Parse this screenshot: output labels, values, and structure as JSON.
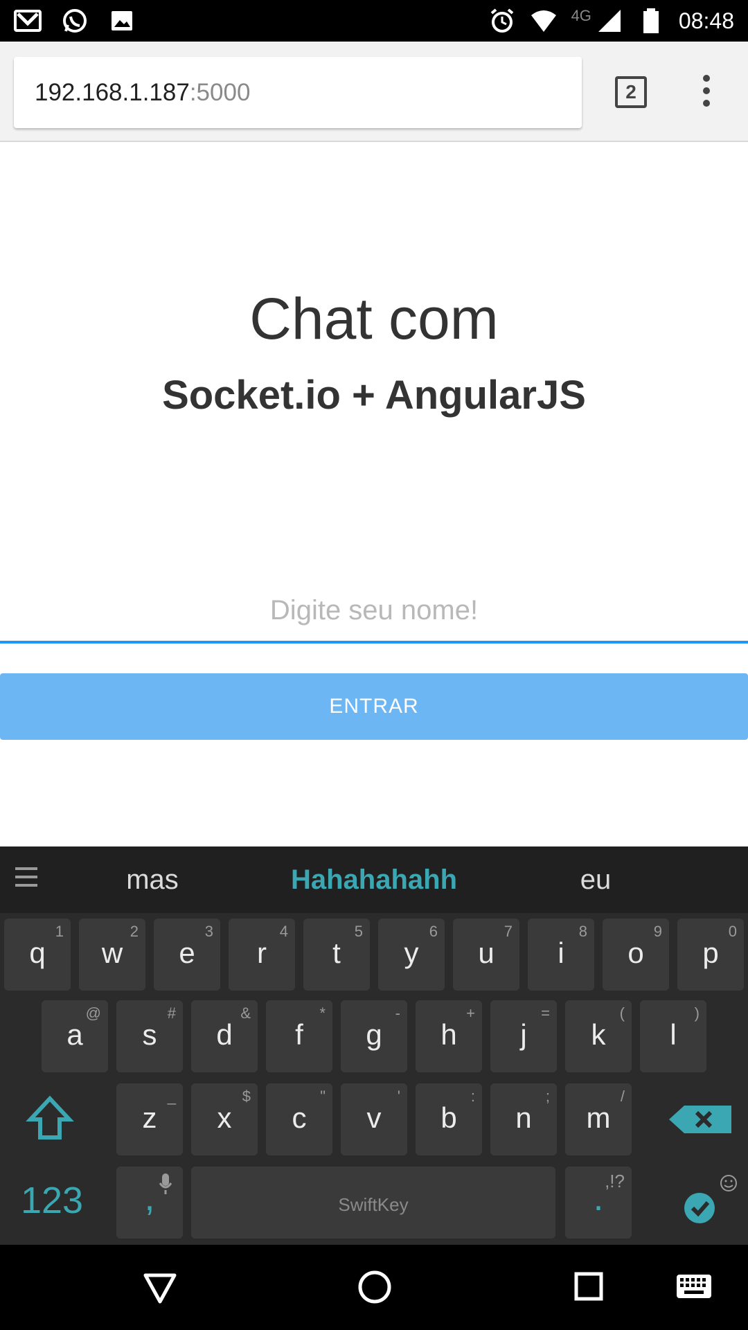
{
  "status_bar": {
    "time": "08:48",
    "network": "4G",
    "left_icons": [
      "gmail-icon",
      "whatsapp-icon",
      "gallery-icon"
    ],
    "right_icons": [
      "alarm-icon",
      "wifi-icon",
      "signal-icon",
      "battery-icon"
    ]
  },
  "browser": {
    "url_host": "192.168.1.187",
    "url_port": ":5000",
    "tab_count": "2",
    "menu_icon": "more-vert-icon"
  },
  "page": {
    "title": "Chat com",
    "subtitle": "Socket.io + AngularJS",
    "name_placeholder": "Digite seu nome!",
    "name_value": "",
    "enter_label": "ENTRAR",
    "accent_color": "#2196f3",
    "button_color": "#6db6f4"
  },
  "keyboard": {
    "suggestions": [
      "mas",
      "Hahahahahh",
      "eu"
    ],
    "row1": [
      {
        "k": "q",
        "h": "1"
      },
      {
        "k": "w",
        "h": "2"
      },
      {
        "k": "e",
        "h": "3"
      },
      {
        "k": "r",
        "h": "4"
      },
      {
        "k": "t",
        "h": "5"
      },
      {
        "k": "y",
        "h": "6"
      },
      {
        "k": "u",
        "h": "7"
      },
      {
        "k": "i",
        "h": "8"
      },
      {
        "k": "o",
        "h": "9"
      },
      {
        "k": "p",
        "h": "0"
      }
    ],
    "row2": [
      {
        "k": "a",
        "h": "@"
      },
      {
        "k": "s",
        "h": "#"
      },
      {
        "k": "d",
        "h": "&"
      },
      {
        "k": "f",
        "h": "*"
      },
      {
        "k": "g",
        "h": "-"
      },
      {
        "k": "h",
        "h": "+"
      },
      {
        "k": "j",
        "h": "="
      },
      {
        "k": "k",
        "h": "("
      },
      {
        "k": "l",
        "h": ")"
      }
    ],
    "row3": [
      {
        "k": "z",
        "h": "_"
      },
      {
        "k": "x",
        "h": "$"
      },
      {
        "k": "c",
        "h": "\""
      },
      {
        "k": "v",
        "h": "'"
      },
      {
        "k": "b",
        "h": ":"
      },
      {
        "k": "n",
        "h": ";"
      },
      {
        "k": "m",
        "h": "/"
      }
    ],
    "numbers_label": "123",
    "comma_label": ",",
    "space_brand": "SwiftKey",
    "period_label": ".",
    "period_hint": ",!?",
    "accent_color": "#3aa7b2"
  },
  "nav_bar": {
    "icons": [
      "back-icon",
      "home-icon",
      "recents-icon",
      "keyboard-icon"
    ]
  }
}
